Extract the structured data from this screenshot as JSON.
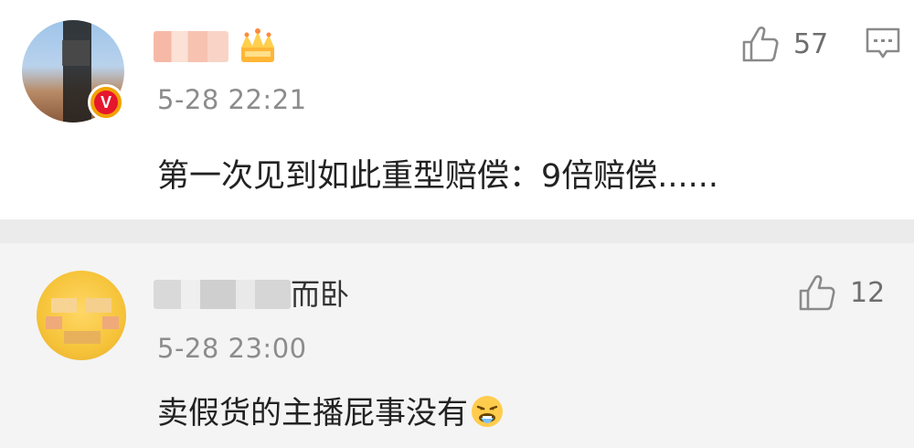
{
  "comments": [
    {
      "author_blurred": true,
      "badge": "V",
      "time": "5-28 22:21",
      "text": "第一次见到如此重型赔偿：9倍赔偿......",
      "likes": "57"
    },
    {
      "author_suffix": "而卧",
      "time": "5-28 23:00",
      "text": "卖假货的主播屁事没有",
      "likes": "12"
    }
  ],
  "icons": {
    "like": "thumbs-up-icon",
    "comment": "comment-bubble-icon",
    "badge": "verified-v-icon",
    "crown": "crown-icon",
    "emoji": "nauseated-face-emoji-icon"
  },
  "colors": {
    "badge_red": "#e6162d",
    "badge_gold": "#f2a100",
    "separator": "#ebebeb",
    "reply_bg": "#f4f4f4",
    "time_gray": "#8c8c8c"
  }
}
